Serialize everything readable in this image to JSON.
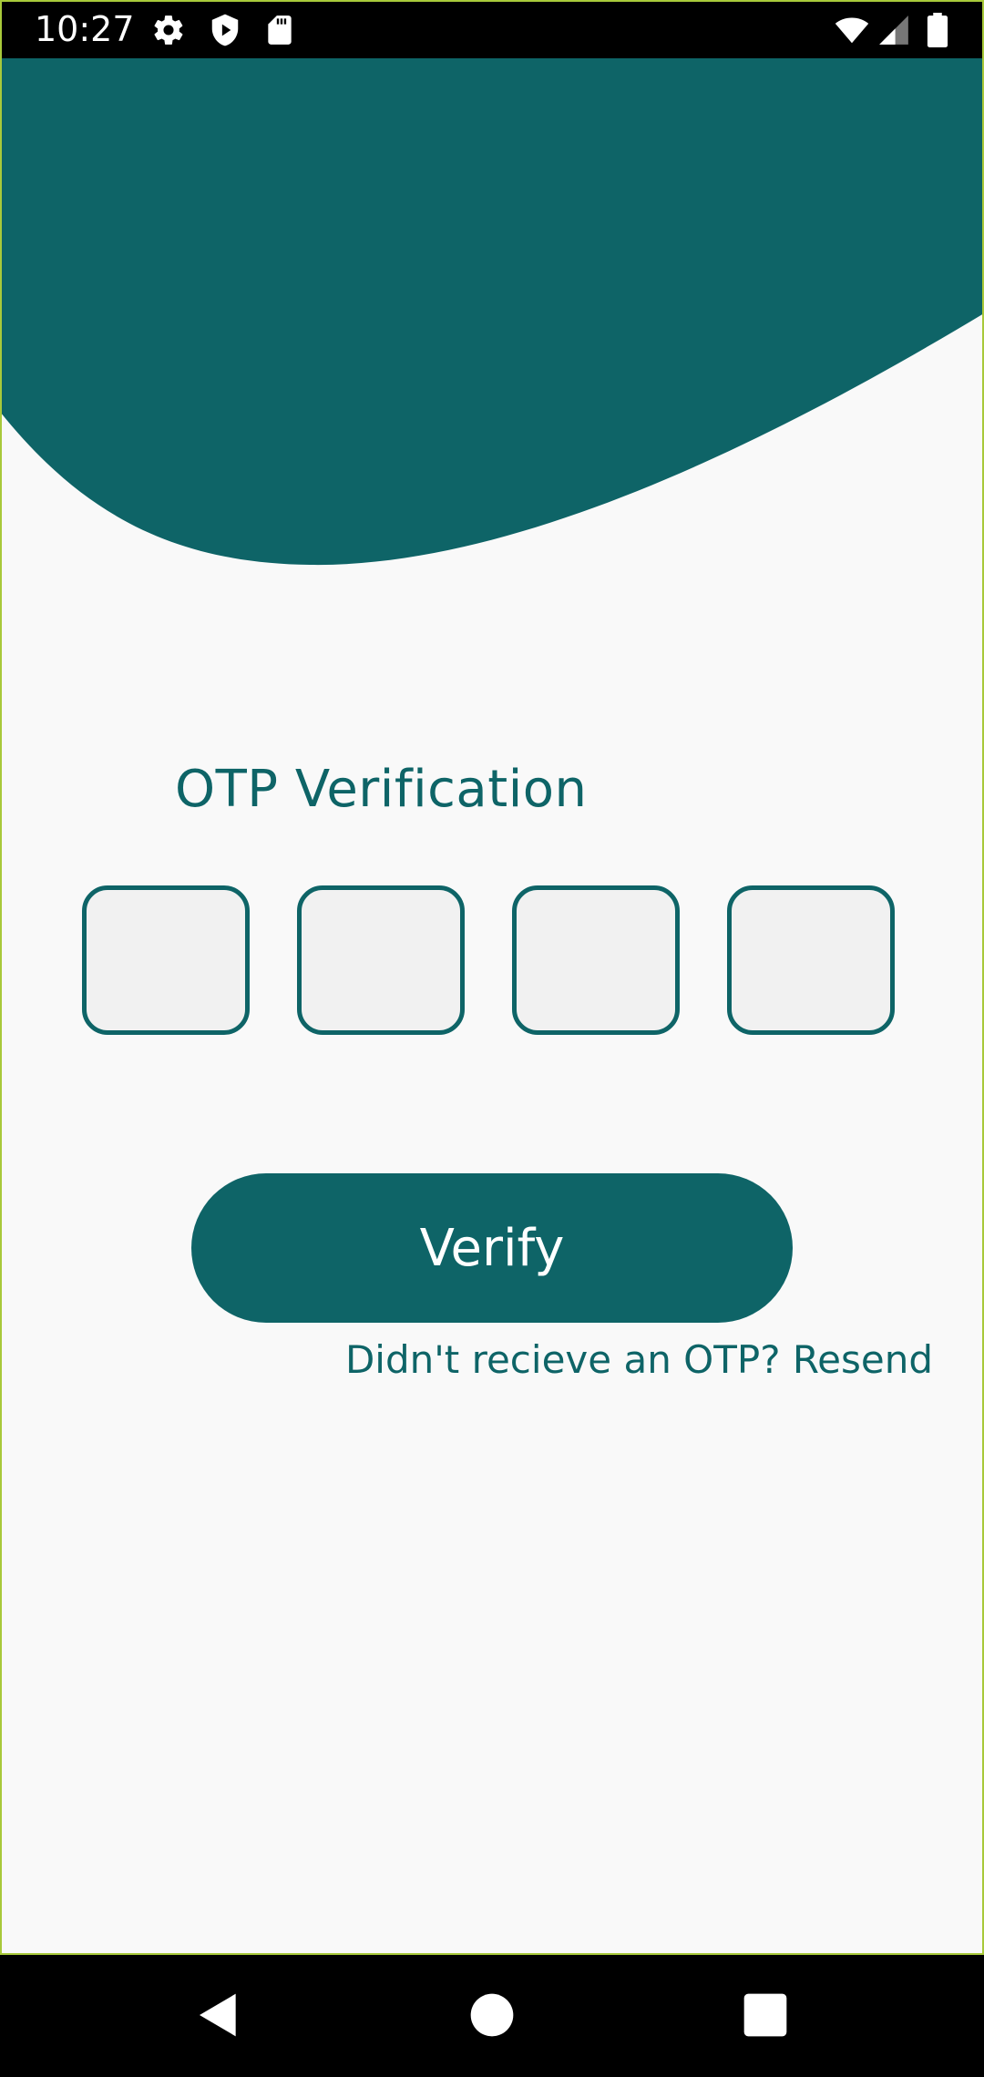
{
  "status_bar": {
    "time": "10:27",
    "icons": [
      "gear-icon",
      "shield-play-icon",
      "sd-card-icon",
      "wifi-icon",
      "cell-signal-icon",
      "battery-icon"
    ]
  },
  "colors": {
    "primary": "#0e6467",
    "background": "#f9f9f9",
    "otp_box_fill": "#f1f1f1",
    "button_text": "#ffffff"
  },
  "otp": {
    "title": "OTP Verification",
    "fields": [
      {
        "value": ""
      },
      {
        "value": ""
      },
      {
        "value": ""
      },
      {
        "value": ""
      }
    ]
  },
  "verify_button": {
    "label": "Verify"
  },
  "resend": {
    "prompt": "Didn't recieve an OTP?",
    "link": "Resend"
  },
  "nav_bar": {
    "buttons": [
      "back-icon",
      "home-icon",
      "recents-icon"
    ]
  }
}
